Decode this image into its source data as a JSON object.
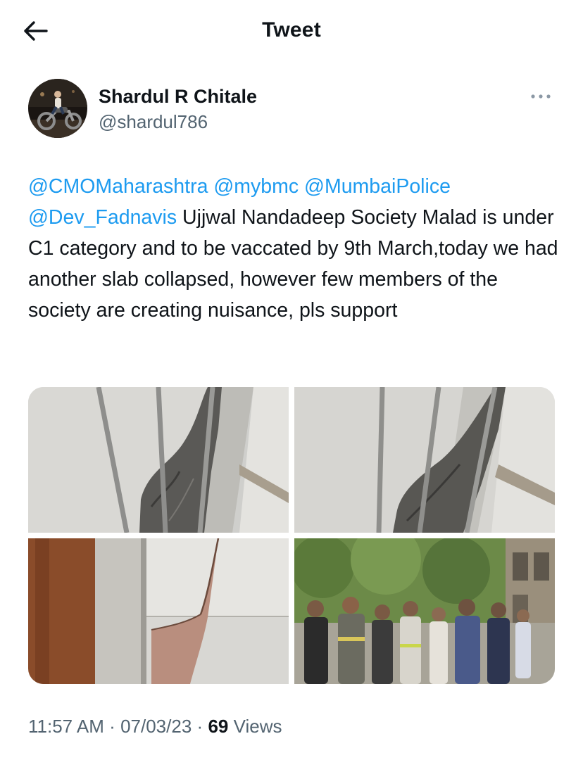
{
  "header": {
    "title": "Tweet",
    "back_icon": "arrow-left-icon"
  },
  "author": {
    "display_name": "Shardul R Chitale",
    "handle": "@shardul786",
    "more_icon": "more-horizontal-icon"
  },
  "tweet": {
    "mentions": [
      "@CMOMaharashtra",
      "@mybmc",
      "@MumbaiPolice",
      "@Dev_Fadnavis"
    ],
    "body": "Ujjwal Nandadeep Society Malad is under C1 category and to be vaccated by 9th March,today we had another slab collapsed, however few members of the society are creating nuisance, pls support"
  },
  "media": {
    "photo_count": 4
  },
  "meta": {
    "time": "11:57 AM",
    "separator": "·",
    "date": "07/03/23",
    "views_count": "69",
    "views_label": "Views"
  },
  "colors": {
    "link": "#1d9bf0",
    "text": "#0f1419",
    "secondary": "#536471"
  }
}
